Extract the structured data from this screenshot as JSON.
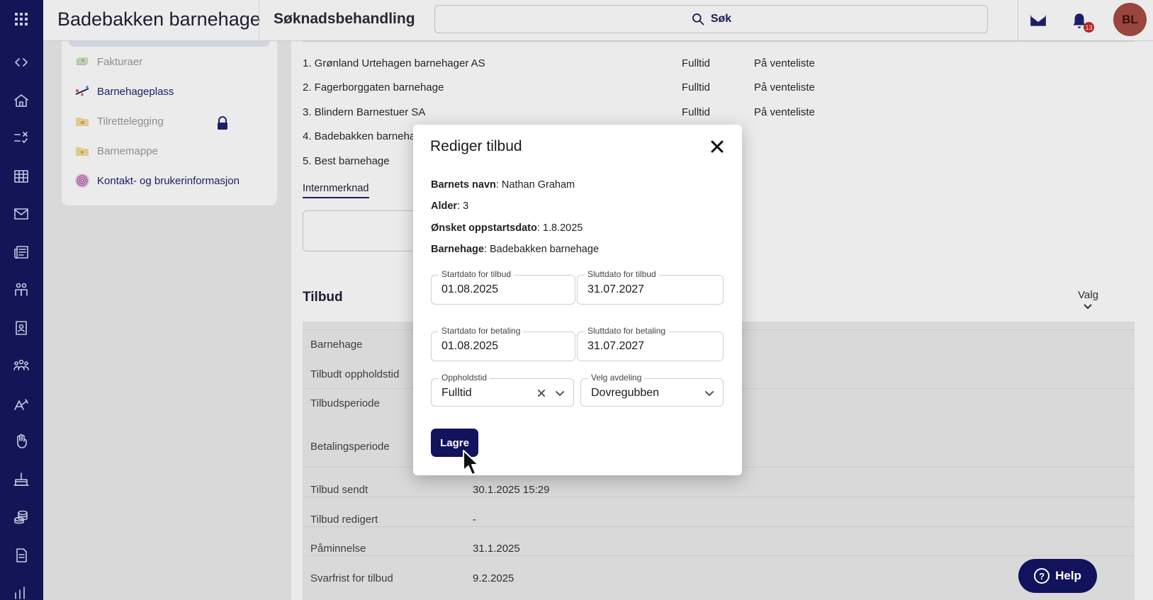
{
  "header": {
    "org_title": "Badebakken barnehage",
    "page_title": "Søknadsbehandling",
    "search_label": "Søk",
    "notification_count": "13",
    "avatar_initials": "BL"
  },
  "sidebar_menu": {
    "items": [
      {
        "label": "Fakturaer",
        "state": "disabled"
      },
      {
        "label": "Barnehageplass",
        "state": "enabled"
      },
      {
        "label": "Tilrettelegging",
        "state": "locked"
      },
      {
        "label": "Barnemappe",
        "state": "disabled"
      },
      {
        "label": "Kontakt- og brukerinformasjon",
        "state": "enabled"
      }
    ]
  },
  "preferences": [
    {
      "name": "1. Grønland Urtehagen barnehager AS",
      "type": "Fulltid",
      "status": "På venteliste"
    },
    {
      "name": "2. Fagerborggaten barnehage",
      "type": "Fulltid",
      "status": "På venteliste"
    },
    {
      "name": "3. Blindern Barnestuer SA",
      "type": "Fulltid",
      "status": "På venteliste"
    },
    {
      "name": "4. Badebakken barnehage",
      "type": "",
      "status": ""
    },
    {
      "name": "5. Best barnehage",
      "type": "",
      "status": ""
    }
  ],
  "intern_tab_label": "Internmerknad",
  "offer_section": {
    "title": "Tilbud",
    "menu_label": "Valg",
    "rows": [
      {
        "label": "Barnehage",
        "value": ""
      },
      {
        "label": "Tilbudt oppholdstid",
        "value": ""
      },
      {
        "label": "Tilbudsperiode",
        "value": ""
      },
      {
        "label": "Betalingsperiode",
        "value": ""
      },
      {
        "label": "Tilbud sendt",
        "value": "30.1.2025 15:29"
      },
      {
        "label": "Tilbud redigert",
        "value": "-"
      },
      {
        "label": "Påminnelse",
        "value": "31.1.2025"
      },
      {
        "label": "Svarfrist for tilbud",
        "value": "9.2.2025"
      }
    ]
  },
  "modal": {
    "title": "Rediger tilbud",
    "info": [
      {
        "label": "Barnets navn",
        "value": ": Nathan Graham"
      },
      {
        "label": "Alder",
        "value": ": 3"
      },
      {
        "label": "Ønsket oppstartsdato",
        "value": ": 1.8.2025"
      },
      {
        "label": "Barnehage",
        "value": ": Badebakken barnehage"
      }
    ],
    "offer_start": {
      "label": "Startdato for tilbud",
      "value": "01.08.2025"
    },
    "offer_end": {
      "label": "Sluttdato for tilbud",
      "value": "31.07.2027"
    },
    "payment_start": {
      "label": "Startdato for betaling",
      "value": "01.08.2025"
    },
    "payment_end": {
      "label": "Sluttdato for betaling",
      "value": "31.07.2027"
    },
    "stay_time": {
      "label": "Oppholdstid",
      "value": "Fulltid"
    },
    "department": {
      "label": "Velg avdeling",
      "value": "Dovregubben"
    },
    "save_label": "Lagre"
  },
  "help_label": "Help",
  "colors": {
    "rail_bg": "#15175e",
    "primary_button": "#12135c",
    "avatar_bg": "#a84b44",
    "badge": "#c62828"
  }
}
